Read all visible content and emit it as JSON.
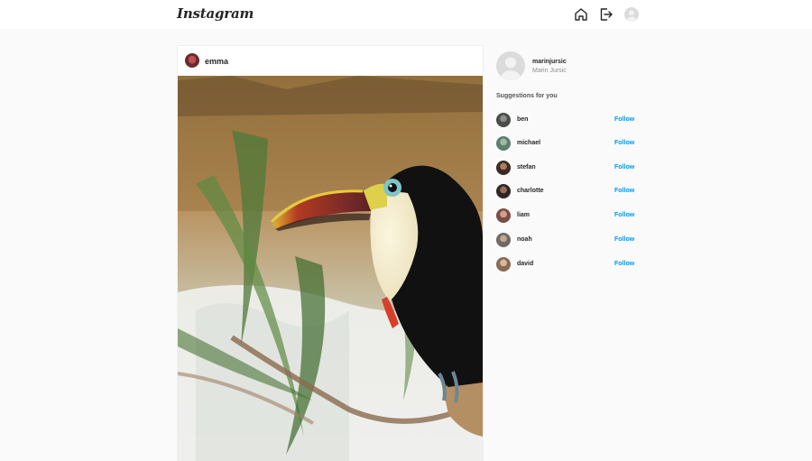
{
  "header": {
    "logo": "Instagram",
    "icons": [
      "home-icon",
      "logout-icon",
      "avatar"
    ]
  },
  "post": {
    "username": "emma",
    "image": "toucan-photo"
  },
  "profile": {
    "username": "marinjursic",
    "full_name": "Marin Jursic"
  },
  "suggestions": {
    "title": "Suggestions for you",
    "follow_label": "Follow",
    "users": [
      {
        "name": "ben"
      },
      {
        "name": "michael"
      },
      {
        "name": "stefan"
      },
      {
        "name": "charlotte"
      },
      {
        "name": "liam"
      },
      {
        "name": "noah"
      },
      {
        "name": "david"
      }
    ]
  },
  "colors": {
    "background": "#fafafa",
    "link": "#0095f6",
    "text": "#262626",
    "muted": "#8e8e8e"
  }
}
